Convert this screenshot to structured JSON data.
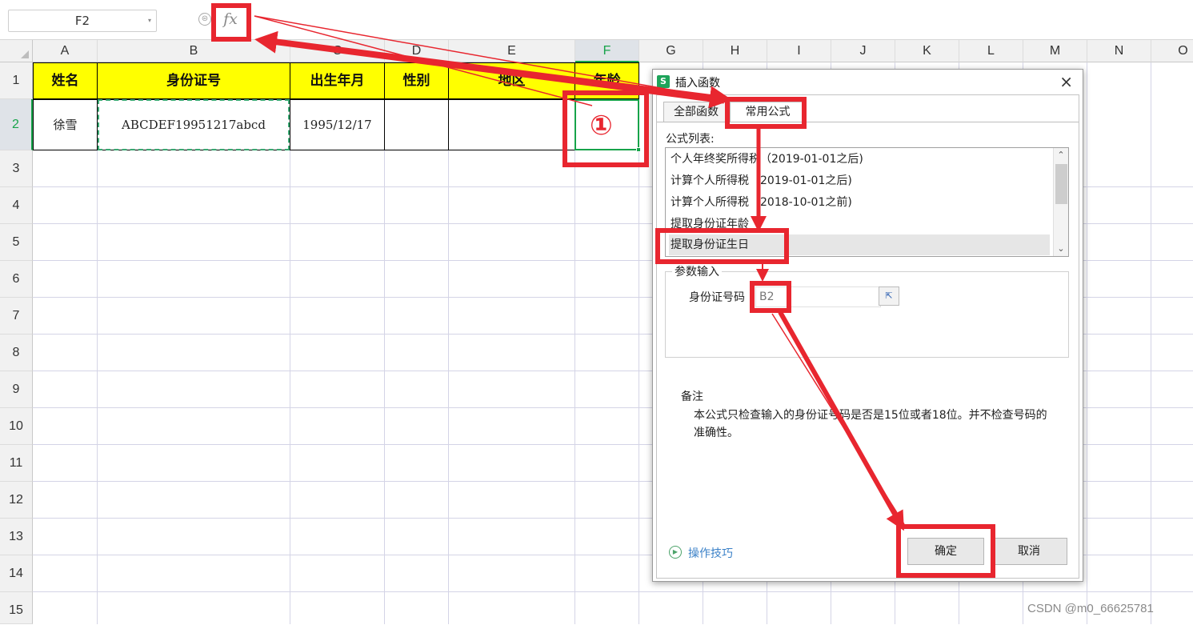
{
  "formula_bar": {
    "name_box": "F2",
    "zoom_icon": "⊜",
    "fx_icon": "fx",
    "formula_value": ""
  },
  "columns": [
    "A",
    "B",
    "C",
    "D",
    "E",
    "F",
    "G",
    "H",
    "I",
    "J",
    "K",
    "L",
    "M",
    "N",
    "O"
  ],
  "rows": [
    "1",
    "2",
    "3",
    "4",
    "5",
    "6",
    "7",
    "8",
    "9",
    "10",
    "11",
    "12",
    "13",
    "14",
    "15"
  ],
  "active_column": "F",
  "active_row": "2",
  "sheet": {
    "headers": [
      "姓名",
      "身份证号",
      "出生年月",
      "性别",
      "地区",
      "年龄"
    ],
    "row2": [
      "徐雪",
      "ABCDEF19951217abcd",
      "1995/12/17",
      "",
      "",
      ""
    ],
    "header_fill": "#ffff00"
  },
  "dialog": {
    "title": "插入函数",
    "logo": "S",
    "close_icon": "×",
    "tabs": [
      "全部函数",
      "常用公式"
    ],
    "active_tab": "常用公式",
    "list_label": "公式列表:",
    "formulas": [
      "个人年终奖所得税（2019-01-01之后)",
      "计算个人所得税（2019-01-01之后)",
      "计算个人所得税（2018-10-01之前)",
      "提取身份证年龄",
      "提取身份证生日"
    ],
    "selected_formula": "提取身份证生日",
    "scroll_up": "⌃",
    "scroll_down": "⌄",
    "param_group": "参数输入",
    "param_label": "身份证号码",
    "param_value": "B2",
    "param_pick_icon": "⇱",
    "note_title": "备注",
    "note_text": "本公式只检查输入的身份证号码是否是15位或者18位。并不检查号码的准确性。",
    "tips_icon": "▶",
    "tips_link": "操作技巧",
    "ok_label": "确定",
    "cancel_label": "取消"
  },
  "annotation": {
    "step_marker": "①",
    "color": "#e8262f"
  },
  "watermark": "CSDN @m0_66625781"
}
